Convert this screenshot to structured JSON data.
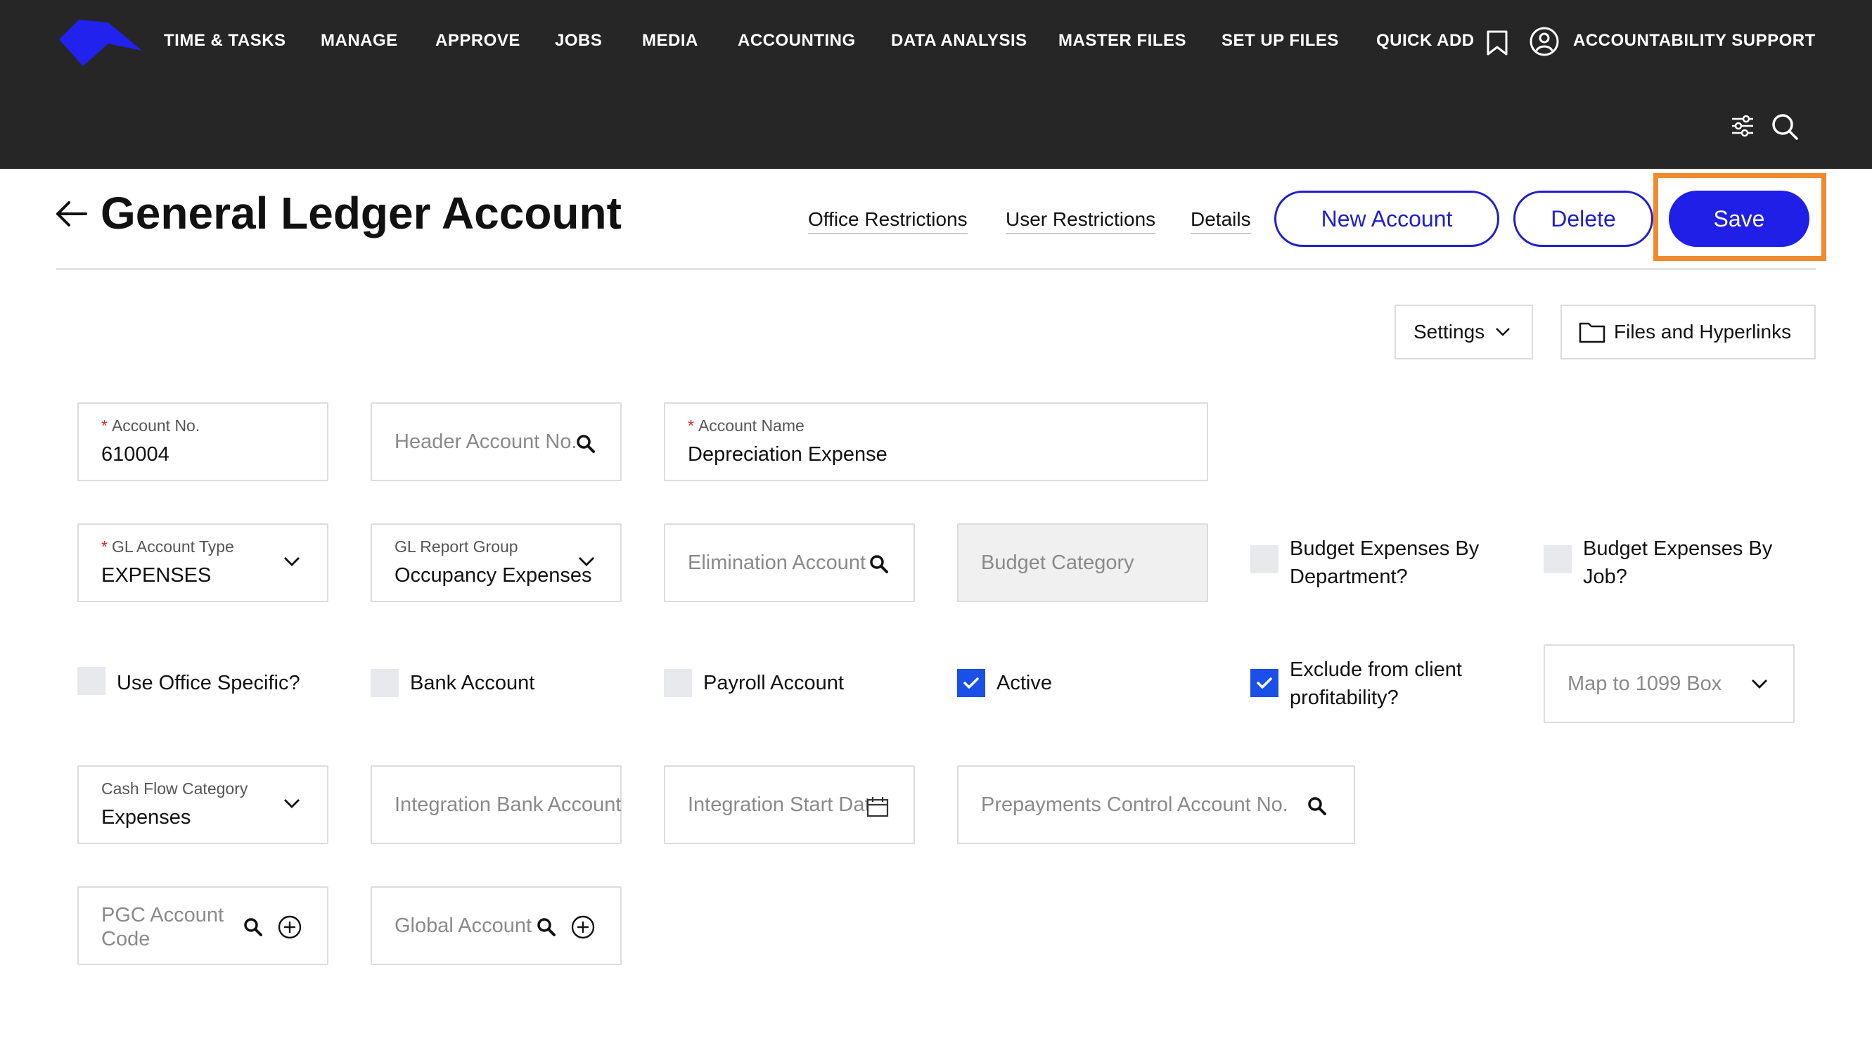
{
  "nav": {
    "items": [
      "TIME & TASKS",
      "MANAGE",
      "APPROVE",
      "JOBS",
      "MEDIA",
      "ACCOUNTING",
      "DATA ANALYSIS",
      "MASTER FILES",
      "SET UP FILES",
      "QUICK ADD"
    ],
    "user_label": "ACCOUNTABILITY SUPPORT",
    "logo_color": "#2222ee"
  },
  "header": {
    "title": "General Ledger Account",
    "links": [
      "Office Restrictions",
      "User Restrictions",
      "Details"
    ],
    "new_account": "New Account",
    "delete": "Delete",
    "save": "Save"
  },
  "toolbar": {
    "settings": "Settings",
    "files": "Files and Hyperlinks"
  },
  "fields": {
    "account_no": {
      "label": "Account No.",
      "value": "610004"
    },
    "header_account_no": {
      "placeholder": "Header Account No."
    },
    "account_name": {
      "label": "Account Name",
      "value": "Depreciation Expense"
    },
    "gl_account_type": {
      "label": "GL Account Type",
      "value": "EXPENSES"
    },
    "gl_report_group": {
      "label": "GL Report Group",
      "value": "Occupancy Expenses"
    },
    "elimination_account": {
      "placeholder": "Elimination Account"
    },
    "budget_category": {
      "placeholder": "Budget Category"
    },
    "map_1099": {
      "placeholder": "Map to 1099 Box"
    },
    "cash_flow_category": {
      "label": "Cash Flow Category",
      "value": "Expenses"
    },
    "integration_bank_account": {
      "placeholder": "Integration Bank Account"
    },
    "integration_start_date": {
      "placeholder": "Integration Start Date"
    },
    "prepayments_control": {
      "placeholder": "Prepayments Control Account No."
    },
    "pgc_account_code": {
      "placeholder": "PGC Account Code"
    },
    "global_account": {
      "placeholder": "Global Account"
    }
  },
  "checkboxes": {
    "budget_by_department": {
      "label": "Budget Expenses By Department?",
      "checked": false
    },
    "budget_by_job": {
      "label": "Budget Expenses By Job?",
      "checked": false
    },
    "use_office_specific": {
      "label": "Use Office Specific?",
      "checked": false
    },
    "bank_account": {
      "label": "Bank Account",
      "checked": false
    },
    "payroll_account": {
      "label": "Payroll Account",
      "checked": false
    },
    "active": {
      "label": "Active",
      "checked": true
    },
    "exclude_client_profitability": {
      "label": "Exclude from client profitability?",
      "checked": true
    }
  },
  "colors": {
    "accent": "#1f1fe8",
    "highlight": "#ef8a2e",
    "topbar": "#262626",
    "checkbox_checked": "#1a4fe8"
  }
}
